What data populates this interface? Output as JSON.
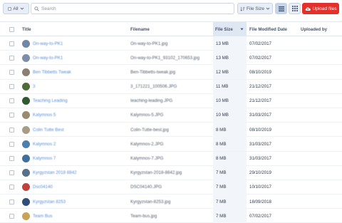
{
  "toolbar": {
    "filter_label": "All",
    "search_placeholder": "Search",
    "sort_label": "File Size",
    "upload_label": "Upload files",
    "accent_color": "#e3302b"
  },
  "table": {
    "columns": {
      "title": "Title",
      "filename": "Filename",
      "file_size": "File Size",
      "modified": "File Modified Date",
      "uploaded_by": "Uploaded by"
    },
    "rows": [
      {
        "title": "On-way-to-PK1",
        "filename": "On-way-to-PK1.jpg",
        "size": "13 MB",
        "date": "07/02/2017",
        "uploaded_by": "",
        "thumb_color": "#6f86a6"
      },
      {
        "title": "On-way-to-PK1",
        "filename": "On-way-to-PK1_93102_170653.jpg",
        "size": "13 MB",
        "date": "07/02/2017",
        "uploaded_by": "",
        "thumb_color": "#7d8fa8"
      },
      {
        "title": "Ben Tibbetts Tweak",
        "filename": "Ben-Tibbetts-tweak.jpg",
        "size": "12 MB",
        "date": "08/10/2019",
        "uploaded_by": "",
        "thumb_color": "#8a7f72"
      },
      {
        "title": "3",
        "filename": "3_171221_100506.JPG",
        "size": "11 MB",
        "date": "21/12/2017",
        "uploaded_by": "",
        "thumb_color": "#4e6b3a"
      },
      {
        "title": "Teaching Leading",
        "filename": "teaching-leading.JPG",
        "size": "10 MB",
        "date": "21/12/2017",
        "uploaded_by": "",
        "thumb_color": "#2f5a2f"
      },
      {
        "title": "Kalymnos 5",
        "filename": "Kalymnos-5.JPG",
        "size": "10 MB",
        "date": "31/03/2017",
        "uploaded_by": "",
        "thumb_color": "#9a8a70"
      },
      {
        "title": "Colin Tutte Best",
        "filename": "Colin-Tutte-best.jpg",
        "size": "8 MB",
        "date": "08/10/2019",
        "uploaded_by": "",
        "thumb_color": "#a99c86"
      },
      {
        "title": "Kalymnos 2",
        "filename": "Kalymnos-2.JPG",
        "size": "8 MB",
        "date": "31/03/2017",
        "uploaded_by": "",
        "thumb_color": "#4c7fae"
      },
      {
        "title": "Kalymnos 7",
        "filename": "Kalymnos-7.JPG",
        "size": "8 MB",
        "date": "31/03/2017",
        "uploaded_by": "",
        "thumb_color": "#3f6f9e"
      },
      {
        "title": "Kyrgyzstan 2018 8842",
        "filename": "Kyrgyzstan-2018-8842.jpg",
        "size": "7 MB",
        "date": "29/10/2019",
        "uploaded_by": "",
        "thumb_color": "#5a6f8a"
      },
      {
        "title": "Dsc04140",
        "filename": "DSC04140.JPG",
        "size": "7 MB",
        "date": "10/10/2017",
        "uploaded_by": "",
        "thumb_color": "#c2413a"
      },
      {
        "title": "Kyrgyzstan 8253",
        "filename": "Kyrgyzstan-8253.jpg",
        "size": "7 MB",
        "date": "18/09/2018",
        "uploaded_by": "",
        "thumb_color": "#2f4f7a"
      },
      {
        "title": "Team Bus",
        "filename": "Team-bus.jpg",
        "size": "7 MB",
        "date": "07/02/2017",
        "uploaded_by": "",
        "thumb_color": "#c9a35a"
      }
    ]
  }
}
